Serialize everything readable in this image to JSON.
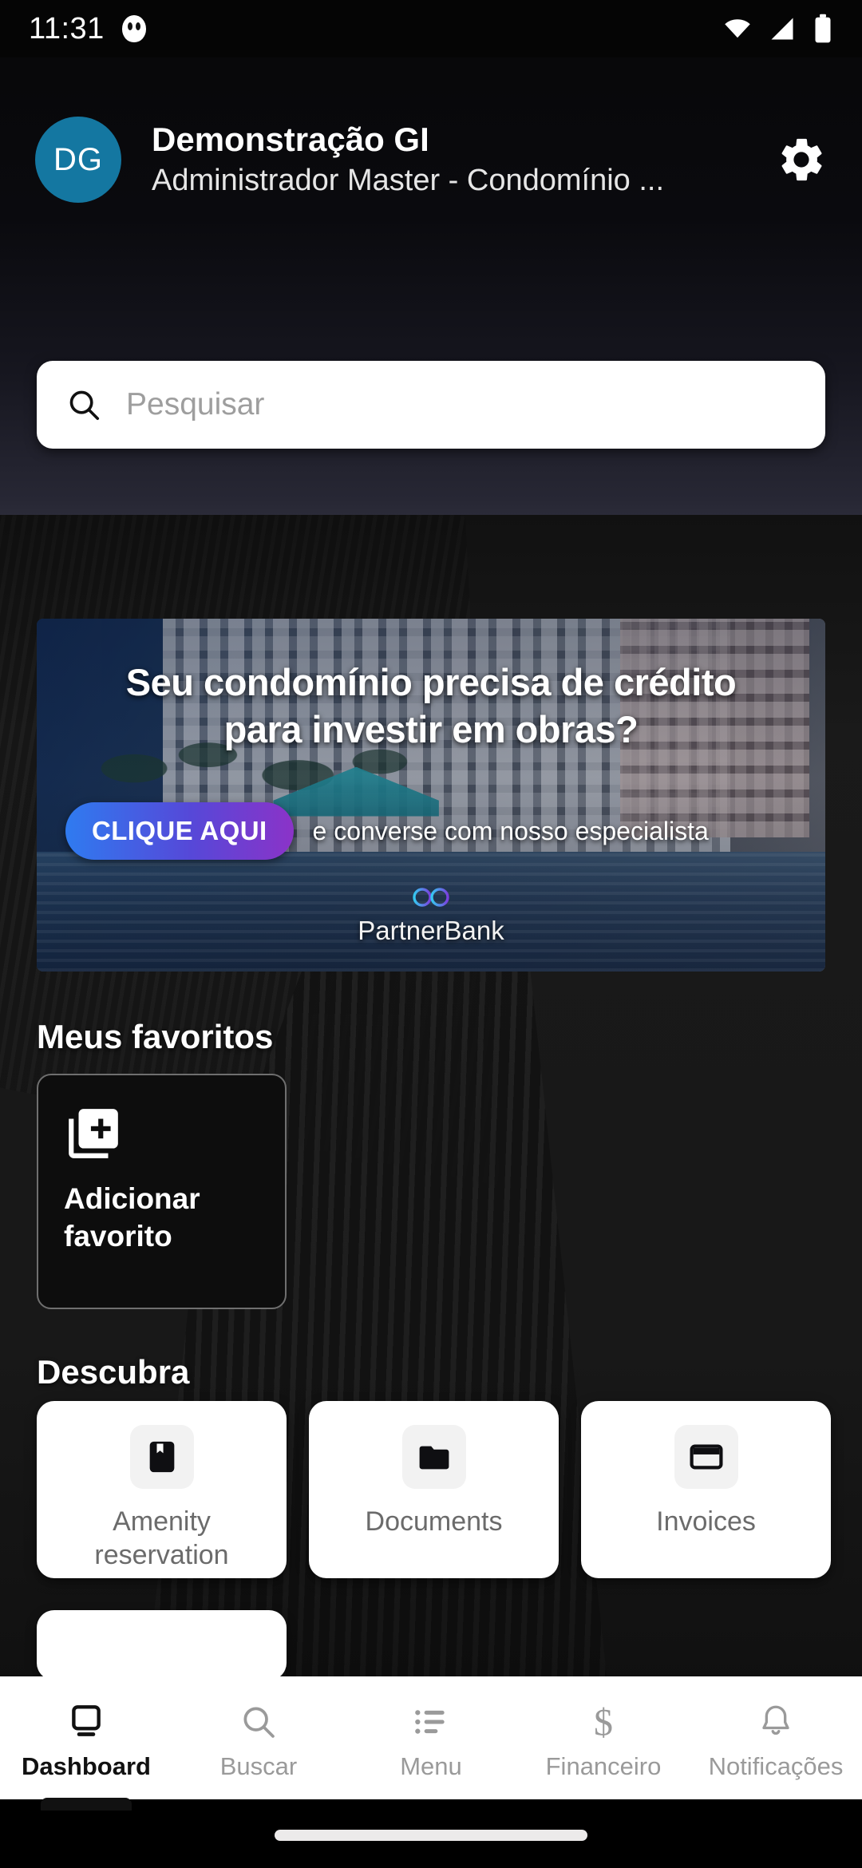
{
  "status_bar": {
    "time": "11:31",
    "icons": [
      "cat-notification-icon",
      "wifi-icon",
      "signal-icon",
      "battery-icon"
    ]
  },
  "header": {
    "avatar_initials": "DG",
    "avatar_color": "#1477a1",
    "title": "Demonstração GI",
    "subtitle": "Administrador Master - Condomínio ...",
    "settings_icon": "gear-icon"
  },
  "search": {
    "placeholder": "Pesquisar",
    "icon": "search-icon",
    "value": ""
  },
  "banner": {
    "headline_line1": "Seu condomínio precisa de crédito",
    "headline_line2": "para investir em obras?",
    "cta_label": "CLIQUE AQUI",
    "cta_text": "e converse com nosso especialista",
    "brand_name": "PartnerBank",
    "brand_icon": "infinity-logo-icon",
    "cta_gradient_start": "#2f7bf0",
    "cta_gradient_end": "#8b33c8"
  },
  "favorites": {
    "section_title": "Meus favoritos",
    "items": [
      {
        "label_line1": "Adicionar",
        "label_line2": "favorito",
        "icon": "library-add-icon"
      }
    ]
  },
  "discover": {
    "section_title": "Descubra",
    "items": [
      {
        "label": "Amenity reservation",
        "icon": "bookmark-book-icon"
      },
      {
        "label": "Documents",
        "icon": "folder-icon"
      },
      {
        "label": "Invoices",
        "icon": "credit-card-icon"
      }
    ]
  },
  "bottom_nav": {
    "active_index": 0,
    "items": [
      {
        "label": "Dashboard",
        "icon": "dashboard-icon"
      },
      {
        "label": "Buscar",
        "icon": "search-icon"
      },
      {
        "label": "Menu",
        "icon": "list-menu-icon"
      },
      {
        "label": "Financeiro",
        "icon": "dollar-icon"
      },
      {
        "label": "Notificações",
        "icon": "bell-icon"
      }
    ]
  }
}
